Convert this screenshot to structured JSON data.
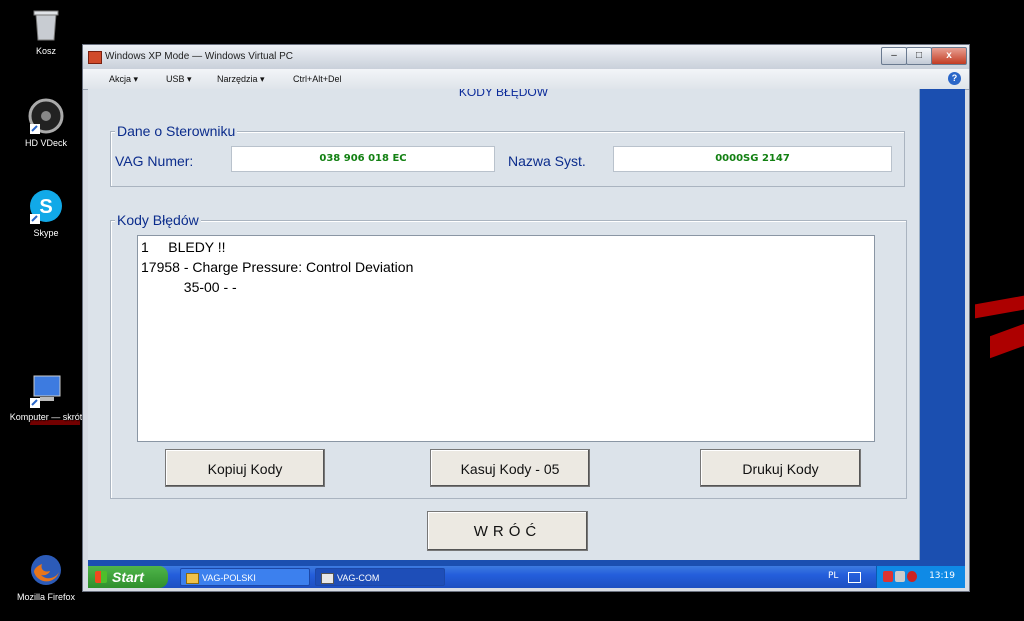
{
  "desktop": {
    "icons": [
      {
        "label": "Kosz",
        "icon": "recycle-bin-icon"
      },
      {
        "label": "HD VDeck",
        "icon": "hd-vdeck-icon"
      },
      {
        "label": "Skype",
        "icon": "skype-icon"
      },
      {
        "label": "Komputer — skrót",
        "icon": "computer-icon"
      },
      {
        "label": "Mozilla Firefox",
        "icon": "firefox-icon"
      }
    ]
  },
  "vpc_window": {
    "title": "Windows XP Mode — Windows Virtual PC",
    "controls": {
      "minimize": "–",
      "maximize": "□",
      "close": "x"
    },
    "menu": [
      "Akcja ▾",
      "USB ▾",
      "Narzędzia ▾",
      "Ctrl+Alt+Del"
    ],
    "help": "?"
  },
  "app": {
    "caption": "KODY BŁĘDÓW",
    "controller_group": {
      "legend": "Dane o Sterowniku",
      "vag_label": "VAG  Numer:",
      "vag_value": "038 906 018 EC",
      "system_label": "Nazwa Syst.",
      "system_value": "0000SG  2147"
    },
    "codes_group": {
      "legend": "Kody Błędów",
      "lines": [
        "1     BLEDY !!",
        "17958 - Charge Pressure: Control Deviation",
        "           35-00 - -"
      ]
    },
    "buttons": {
      "copy": "Kopiuj Kody",
      "clear": "Kasuj Kody - 05",
      "print": "Drukuj Kody",
      "back": "WRÓĆ"
    }
  },
  "taskbar": {
    "start": "Start",
    "tasks": [
      {
        "label": "VAG-POLSKI",
        "icon": "folder-icon"
      },
      {
        "label": "VAG-COM",
        "icon": "vagcom-icon"
      }
    ],
    "language": "PL",
    "clock": "13:19"
  },
  "colors": {
    "app_label": "#0b2c8c",
    "value_text": "#128012",
    "guest_desktop": "#1b4fb0"
  }
}
